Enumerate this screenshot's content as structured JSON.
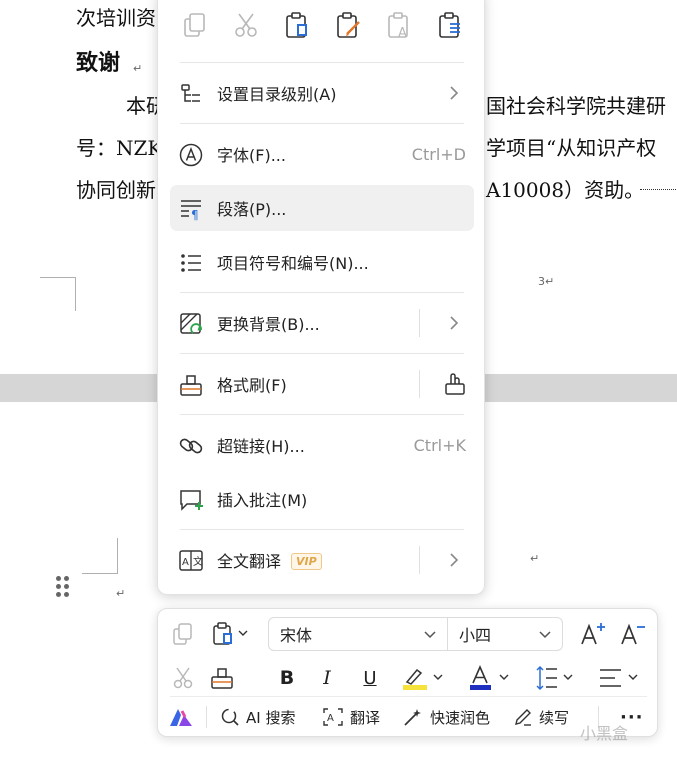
{
  "document": {
    "line1": "次培训资",
    "heading": "致谢",
    "line3_left": "本研",
    "line3_right": "国社会科学院共建研",
    "line4_left": "号：NZK",
    "line4_right": "学项目“从知识产权",
    "line5_left": "协同创新",
    "line5_right": "A10008）资助。",
    "page_number": "3",
    "para_mark": "↵"
  },
  "context_menu": {
    "icon_bar": [
      "copy-icon",
      "cut-icon",
      "paste-keep-format-icon",
      "paste-merge-format-icon",
      "paste-text-only-icon",
      "paste-special-icon"
    ],
    "items": [
      {
        "label": "设置目录级别(A)",
        "icon": "toc-level-icon",
        "shortcut": "",
        "submenu": true
      },
      {
        "label": "字体(F)...",
        "icon": "font-icon",
        "shortcut": "Ctrl+D",
        "submenu": false
      },
      {
        "label": "段落(P)...",
        "icon": "paragraph-icon",
        "shortcut": "",
        "submenu": false,
        "highlighted": true
      },
      {
        "label": "项目符号和编号(N)...",
        "icon": "bullets-numbering-icon",
        "shortcut": "",
        "submenu": false
      },
      {
        "label": "更换背景(B)...",
        "icon": "change-background-icon",
        "shortcut": "",
        "submenu": true
      },
      {
        "label": "格式刷(F)",
        "icon": "format-painter-icon",
        "shortcut": "",
        "submenu": false
      },
      {
        "label": "超链接(H)...",
        "icon": "hyperlink-icon",
        "shortcut": "Ctrl+K",
        "submenu": false
      },
      {
        "label": "插入批注(M)",
        "icon": "insert-comment-icon",
        "shortcut": "",
        "submenu": false
      },
      {
        "label": "全文翻译",
        "icon": "translate-document-icon",
        "shortcut": "",
        "submenu": true,
        "badge": "VIP"
      }
    ]
  },
  "toolbar": {
    "font_name": "宋体",
    "font_size": "小四",
    "bold": "B",
    "italic": "I",
    "underline": "U",
    "highlight_color": "#f5e23a",
    "font_color": "#1f2fbf",
    "ai_search": "AI 搜索",
    "translate": "翻译",
    "quick_polish": "快速润色",
    "continue_write": "续写",
    "more": "···"
  },
  "watermark": "小黑盒",
  "colors": {
    "accent_blue": "#2b6fd6",
    "icon_gray": "#555555",
    "disabled_gray": "#b8b8b8",
    "menu_hover": "#f0f0f0",
    "vip_gold": "#e0a64a"
  }
}
